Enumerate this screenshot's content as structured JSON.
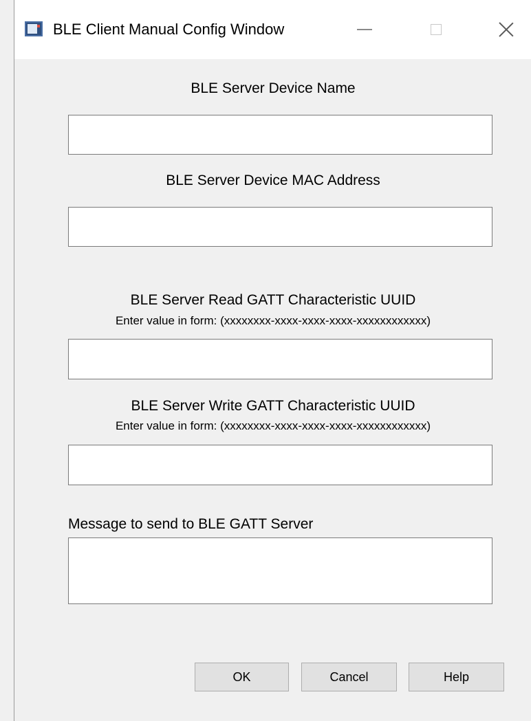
{
  "window": {
    "title": "BLE Client Manual Config Window"
  },
  "titlebar_icons": {
    "minimize": "minimize-icon",
    "maximize": "maximize-icon",
    "close": "close-icon"
  },
  "form": {
    "device_name_label": "BLE Server Device Name",
    "device_name_value": "",
    "mac_label": "BLE Server Device MAC Address",
    "mac_value": "",
    "read_uuid_label": "BLE Server Read GATT Characteristic UUID",
    "read_uuid_hint": "Enter value in form: (xxxxxxxx-xxxx-xxxx-xxxx-xxxxxxxxxxxx)",
    "read_uuid_value": "",
    "write_uuid_label": "BLE Server Write GATT Characteristic UUID",
    "write_uuid_hint": "Enter value in form: (xxxxxxxx-xxxx-xxxx-xxxx-xxxxxxxxxxxx)",
    "write_uuid_value": "",
    "message_label": "Message to send to BLE GATT Server",
    "message_value": ""
  },
  "buttons": {
    "ok": "OK",
    "cancel": "Cancel",
    "help": "Help"
  }
}
